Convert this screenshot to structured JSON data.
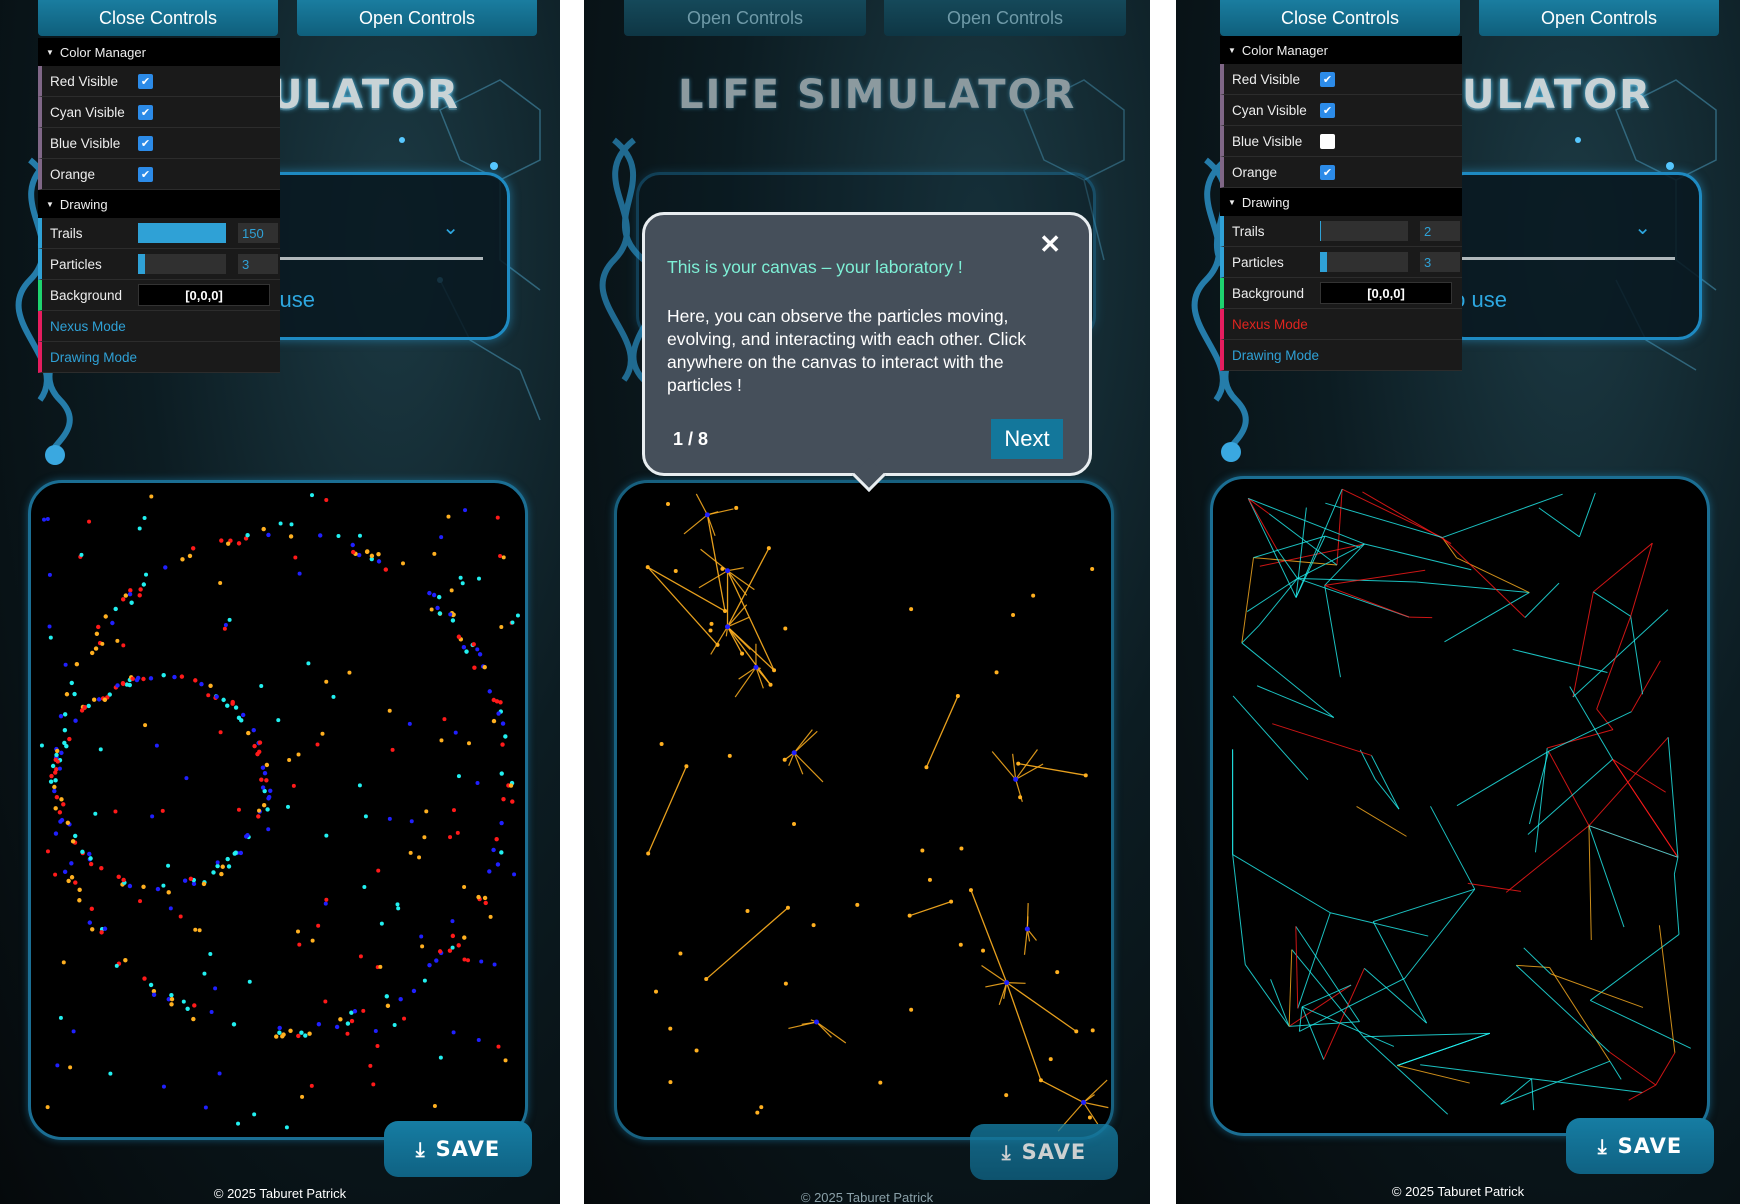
{
  "app": {
    "title": "LIFE SIMULATOR",
    "title_partial": "ULATOR",
    "copyright": "© 2025 Taburet Patrick"
  },
  "topbar": {
    "close_label": "Close Controls",
    "open_label": "Open Controls"
  },
  "card": {
    "use_text": "to use"
  },
  "save": {
    "label": "SAVE",
    "icon": "download-icon"
  },
  "panel1": {
    "color_manager": {
      "title": "Color Manager",
      "items": [
        {
          "label": "Red Visible",
          "checked": true
        },
        {
          "label": "Cyan Visible",
          "checked": true
        },
        {
          "label": "Blue Visible",
          "checked": true
        },
        {
          "label": "Orange",
          "checked": true
        }
      ]
    },
    "drawing": {
      "title": "Drawing",
      "trails": {
        "label": "Trails",
        "value": "150",
        "fill": 1.0
      },
      "particles": {
        "label": "Particles",
        "value": "3",
        "fill": 0.08
      },
      "background": {
        "label": "Background",
        "value": "[0,0,0]"
      }
    },
    "nexus_mode": "Nexus Mode",
    "drawing_mode": "Drawing Mode"
  },
  "panel3": {
    "color_manager": {
      "title": "Color Manager",
      "items": [
        {
          "label": "Red Visible",
          "checked": true
        },
        {
          "label": "Cyan Visible",
          "checked": true
        },
        {
          "label": "Blue Visible",
          "checked": false
        },
        {
          "label": "Orange",
          "checked": true
        }
      ]
    },
    "drawing": {
      "title": "Drawing",
      "trails": {
        "label": "Trails",
        "value": "2",
        "fill": 0.01
      },
      "particles": {
        "label": "Particles",
        "value": "3",
        "fill": 0.08
      },
      "background": {
        "label": "Background",
        "value": "[0,0,0]"
      }
    },
    "nexus_mode": "Nexus Mode",
    "drawing_mode": "Drawing Mode"
  },
  "tour": {
    "heading": "This is your canvas – your laboratory !",
    "body": "Here, you can observe the particles moving, evolving, and interacting with each other. Click anywhere on the canvas to interact with the particles !",
    "page": "1 / 8",
    "next_label": "Next",
    "close_icon": "close-icon"
  },
  "colors": {
    "accent": "#1e8ac2",
    "red": "#ff1a1a",
    "cyan": "#22f0f0",
    "blue": "#2020ff",
    "orange": "#ffb020"
  }
}
